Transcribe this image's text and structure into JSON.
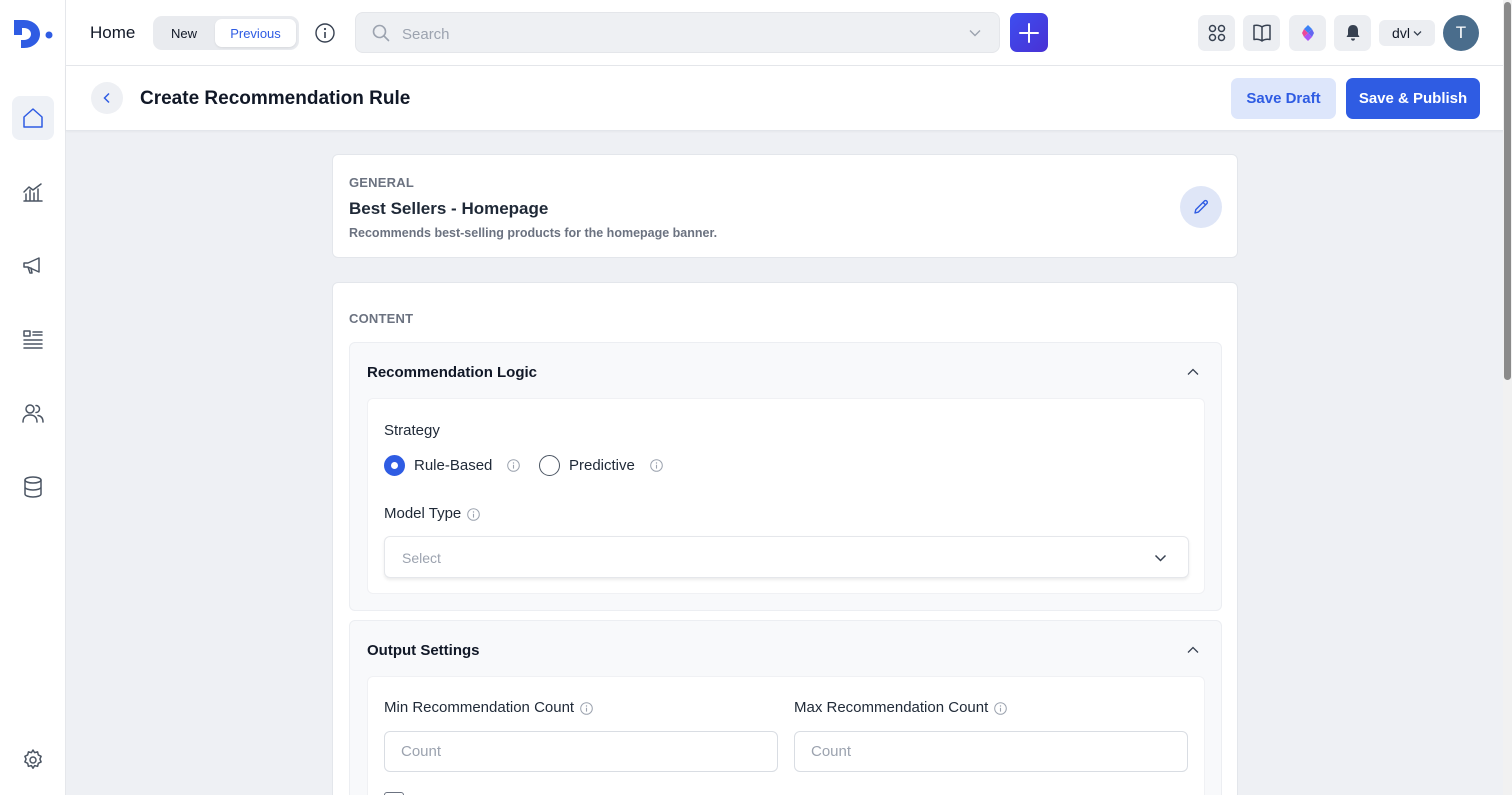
{
  "topbar": {
    "home_label": "Home",
    "toggle": {
      "new_label": "New",
      "previous_label": "Previous",
      "selected": "Previous"
    },
    "search": {
      "placeholder": "Search",
      "value": ""
    },
    "workspace": "dvl",
    "avatar_initial": "T",
    "accent": "#2f5ce3"
  },
  "sidebar": {
    "items": [
      {
        "icon": "home-icon",
        "active": true
      },
      {
        "icon": "analytics-icon",
        "active": false
      },
      {
        "icon": "megaphone-icon",
        "active": false
      },
      {
        "icon": "list-icon",
        "active": false
      },
      {
        "icon": "users-icon",
        "active": false
      },
      {
        "icon": "database-icon",
        "active": false
      }
    ],
    "settings_icon": "gear-icon"
  },
  "header": {
    "title": "Create Recommendation Rule",
    "save_draft": "Save Draft",
    "save_publish": "Save & Publish"
  },
  "general": {
    "eyebrow": "GENERAL",
    "title": "Best Sellers - Homepage",
    "description": "Recommends best-selling products for the homepage banner."
  },
  "content": {
    "eyebrow": "CONTENT",
    "logic": {
      "title": "Recommendation Logic",
      "strategy_label": "Strategy",
      "options": [
        {
          "label": "Rule-Based",
          "selected": true
        },
        {
          "label": "Predictive",
          "selected": false
        }
      ],
      "model_type_label": "Model Type",
      "model_type_placeholder": "Select",
      "model_type_value": ""
    },
    "output": {
      "title": "Output Settings",
      "min_label": "Min Recommendation Count",
      "max_label": "Max Recommendation Count",
      "min_placeholder": "Count",
      "max_placeholder": "Count",
      "min_value": "",
      "max_value": ""
    }
  }
}
